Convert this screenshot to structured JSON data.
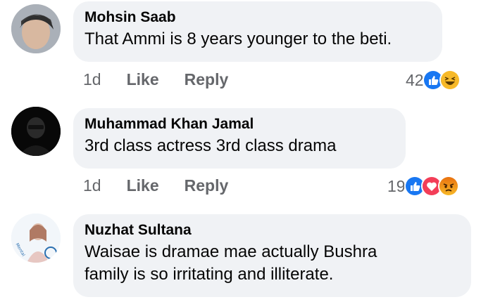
{
  "comments": [
    {
      "author": "Mohsin Saab",
      "text": "That Ammi is 8 years younger to the beti.",
      "time": "1d",
      "like": "Like",
      "reply": "Reply",
      "reaction_count": "42",
      "reactions": [
        "like-icon",
        "haha-icon"
      ]
    },
    {
      "author": "Muhammad Khan Jamal",
      "text": "3rd class actress 3rd class drama",
      "time": "1d",
      "like": "Like",
      "reply": "Reply",
      "reaction_count": "19",
      "reactions": [
        "like-icon",
        "love-icon",
        "angry-icon"
      ]
    },
    {
      "author": "Nuzhat Sultana",
      "text_line1": "Waisae is dramae mae actually Bushra",
      "text_line2": "family is so irritating and illiterate."
    }
  ],
  "colors": {
    "bubble": "#f0f2f5",
    "meta": "#65676b",
    "like_blue": "#1877f2",
    "love_red": "#f33e58",
    "haha_yellow": "#f7b928",
    "angry_orange": "#e9710f"
  }
}
